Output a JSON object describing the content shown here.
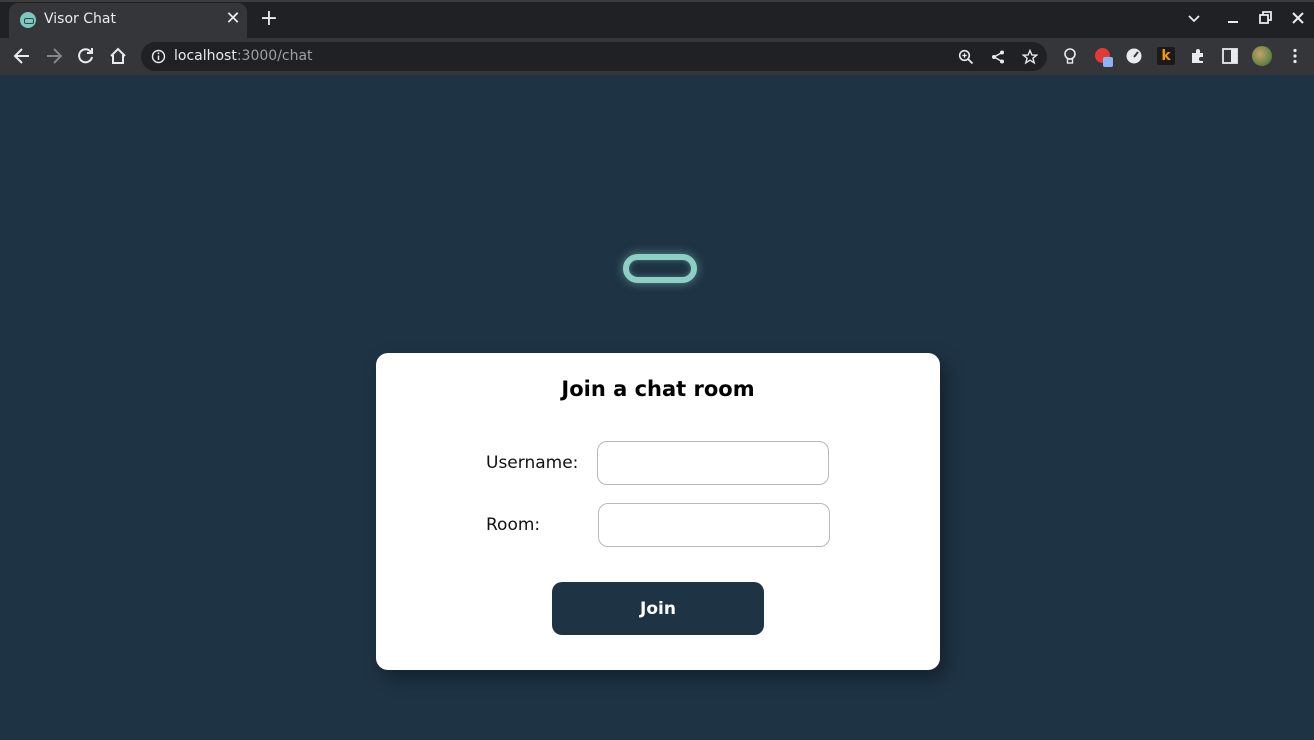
{
  "browser": {
    "tab": {
      "title": "Visor Chat",
      "close_label": "✕"
    },
    "new_tab_label": "+",
    "address": {
      "host": "localhost",
      "path": ":3000/chat"
    }
  },
  "page": {
    "card": {
      "title": "Join a chat room",
      "username_label": "Username:",
      "username_value": "",
      "room_label": "Room:",
      "room_value": "",
      "join_label": "Join"
    }
  },
  "colors": {
    "background": "#1e3344",
    "logo": "#8ecfc4",
    "card": "#ffffff",
    "button": "#1e3344"
  }
}
